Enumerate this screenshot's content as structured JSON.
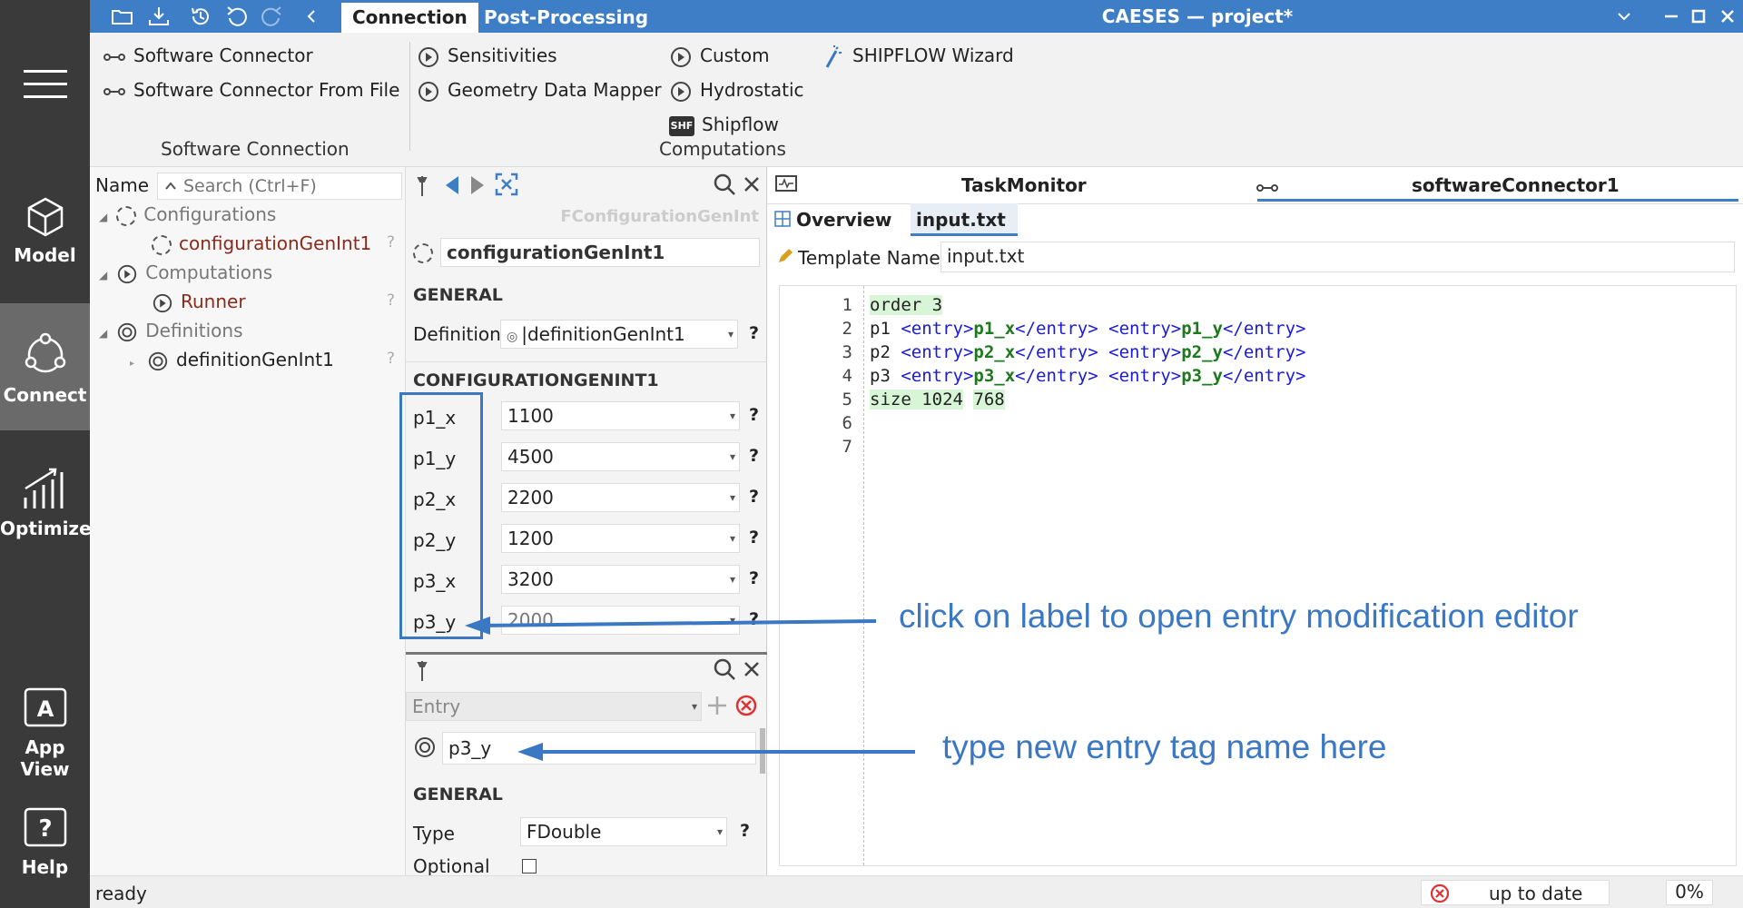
{
  "rail": {
    "items": [
      {
        "label": "Model"
      },
      {
        "label": "Connect"
      },
      {
        "label": "Optimize"
      },
      {
        "label": "App View"
      },
      {
        "label": "Help"
      }
    ]
  },
  "titlebar": {
    "tabs": [
      "Connection",
      "Post-Processing"
    ],
    "title": "CAESES — project*"
  },
  "ribbon": {
    "software_connector": "Software Connector",
    "software_connector_from_file": "Software Connector From File",
    "group_software": "Software Connection",
    "sensitivities": "Sensitivities",
    "geometry_data_mapper": "Geometry Data Mapper",
    "custom": "Custom",
    "hydrostatic": "Hydrostatic",
    "shipflow": "Shipflow",
    "group_computations": "Computations",
    "shipflow_wizard": "SHIPFLOW Wizard",
    "shf_badge": "SHF"
  },
  "tree": {
    "name_header": "Name",
    "search_placeholder": "Search (Ctrl+F)",
    "configurations": "Configurations",
    "config_item": "configurationGenInt1",
    "computations": "Computations",
    "runner": "Runner",
    "definitions": "Definitions",
    "definition_item": "definitionGenInt1",
    "q": "?"
  },
  "props": {
    "type_label": "FConfigurationGenInt",
    "name_value": "configurationGenInt1",
    "general": "GENERAL",
    "definition_label": "Definition",
    "definition_value": "|definitionGenInt1",
    "section_title": "CONFIGURATIONGENINT1",
    "params": [
      {
        "label": "p1_x",
        "value": "1100"
      },
      {
        "label": "p1_y",
        "value": "4500"
      },
      {
        "label": "p2_x",
        "value": "2200"
      },
      {
        "label": "p2_y",
        "value": "1200"
      },
      {
        "label": "p3_x",
        "value": "3200"
      },
      {
        "label": "p3_y",
        "value": "2000"
      }
    ],
    "entry_placeholder": "Entry",
    "entry_value": "p3_y",
    "general2": "GENERAL",
    "type_field_label": "Type",
    "type_field_value": "FDouble",
    "optional_label": "Optional",
    "qm": "?"
  },
  "right": {
    "taskmonitor": "TaskMonitor",
    "connector_tab": "softwareConnector1",
    "subtabs": [
      "Overview",
      "input.txt"
    ],
    "template_label": "Template Name",
    "template_value": "input.txt"
  },
  "editor": {
    "line_numbers": [
      "1",
      "2",
      "3",
      "4",
      "5",
      "6",
      "7"
    ],
    "l1": "order 3",
    "l2a": "p1 ",
    "l2b": "<entry>",
    "l2c": "p1_x",
    "l2d": "</entry>",
    "l2e": " ",
    "l2f": "<entry>",
    "l2g": "p1_y",
    "l2h": "</entry>",
    "l3a": "p2 ",
    "l3b": "<entry>",
    "l3c": "p2_x",
    "l3d": "</entry>",
    "l3e": " ",
    "l3f": "<entry>",
    "l3g": "p2_y",
    "l3h": "</entry>",
    "l4a": "p3 ",
    "l4b": "<entry>",
    "l4c": "p3_x",
    "l4d": "</entry>",
    "l4e": " ",
    "l4f": "<entry>",
    "l4g": "p3_y",
    "l4h": "</entry>",
    "l5a": "size 1024",
    "l5b": "768"
  },
  "status": {
    "text": "ready",
    "state": "up to date",
    "percent": "0%"
  },
  "annotations": {
    "label_hint": "click on label to open entry modification editor",
    "entry_hint": "type new entry tag name here"
  },
  "colors": {
    "accent": "#3d7ec6",
    "annotation": "#3b78c4",
    "rail": "#3a3a3a"
  }
}
